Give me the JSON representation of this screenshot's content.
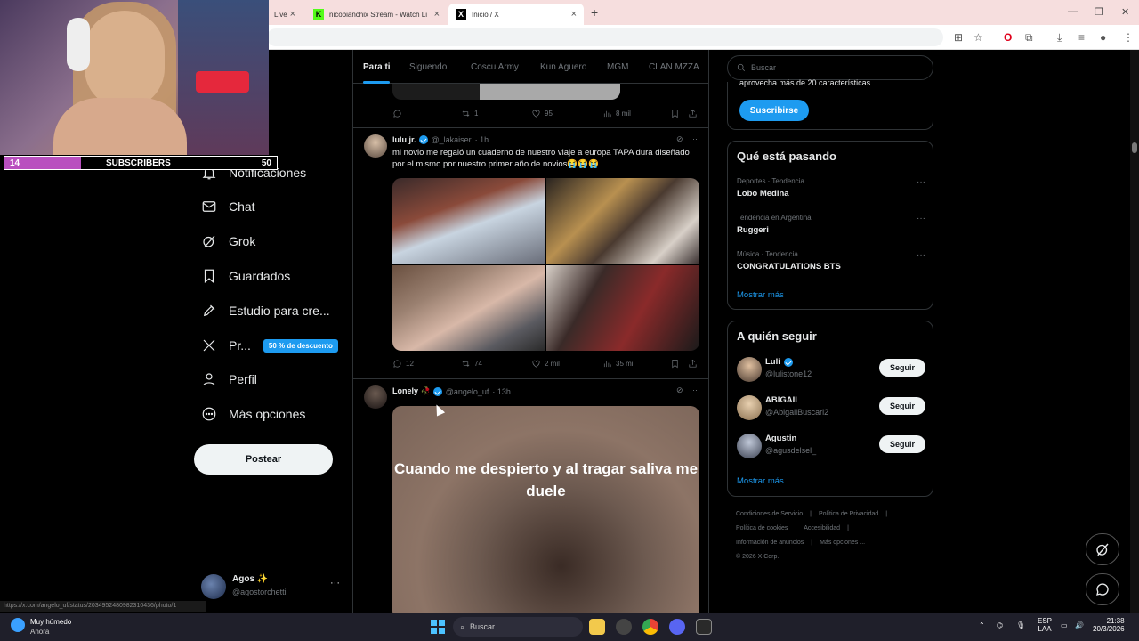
{
  "browser": {
    "tabs": [
      {
        "label": "Live"
      },
      {
        "label": "nicobianchix Stream - Watch Li"
      },
      {
        "label": "Inicio / X"
      }
    ],
    "new_tab": "+"
  },
  "stream_overlay": {
    "sub_count": "14",
    "sub_label": "SUBSCRIBERS",
    "sub_goal": "50",
    "sub_progress": 0.28
  },
  "nav": {
    "items": [
      {
        "label": "Notificaciones",
        "icon": "bell-icon"
      },
      {
        "label": "Chat",
        "icon": "mail-icon"
      },
      {
        "label": "Grok",
        "icon": "grok-icon"
      },
      {
        "label": "Guardados",
        "icon": "bookmark-icon"
      },
      {
        "label": "Estudio para cre...",
        "icon": "rocket-icon"
      },
      {
        "label": "Pr...",
        "icon": "x-logo-icon",
        "badge": "50 % de descuento"
      },
      {
        "label": "Perfil",
        "icon": "person-icon"
      },
      {
        "label": "Más opciones",
        "icon": "more-circle-icon"
      }
    ],
    "post_button": "Postear",
    "account": {
      "name": "Agos ✨",
      "handle": "@agostorchetti"
    },
    "status_url": "https://x.com/angelo_uf/status/2034952480982310436/photo/1"
  },
  "timeline": {
    "tabs": [
      "Para ti",
      "Siguendo",
      "Coscu Army",
      "Kun Aguero",
      "MGM",
      "CLAN MZZA"
    ],
    "prev_tweet_actions": {
      "replies": "",
      "reposts": "1",
      "likes": "95",
      "views": "8 mil"
    },
    "tweets": [
      {
        "name": "lulu jr.",
        "handle": "@_lakaiser",
        "time": "· 1h",
        "text": "mi novio me regaló un cuaderno de nuestro viaje a europa TAPA dura diseñado por el mismo por nuestro primer año de novios😭😭😭",
        "actions": {
          "replies": "12",
          "reposts": "74",
          "likes": "2 mil",
          "views": "35 mil"
        }
      },
      {
        "name": "Lonely 🥀",
        "handle": "@angelo_uf",
        "time": "· 13h",
        "media_caption": "Cuando me despierto y al tragar saliva me duele"
      }
    ]
  },
  "sidebar": {
    "search_placeholder": "Buscar",
    "premium_text": "aprovecha más de 20 características.",
    "subscribe_button": "Suscribirse",
    "trending_title": "Qué está pasando",
    "trends": [
      {
        "context": "Deportes · Tendencia",
        "title": "Lobo Medina"
      },
      {
        "context": "Tendencia en Argentina",
        "title": "Ruggeri"
      },
      {
        "context": "Música · Tendencia",
        "title": "CONGRATULATIONS BTS"
      }
    ],
    "show_more": "Mostrar más",
    "who_to_follow_title": "A quién seguir",
    "follow_suggestions": [
      {
        "name": "Luli",
        "handle": "@lulistone12",
        "verified": true
      },
      {
        "name": "ABIGAIL",
        "handle": "@AbigailBuscarl2",
        "verified": false
      },
      {
        "name": "Agustin",
        "handle": "@agusdelsel_",
        "verified": false
      }
    ],
    "follow_button": "Seguir",
    "footer": [
      "Condiciones de Servicio",
      "|",
      "Política de Privacidad",
      "|",
      "Política de cookies",
      "|",
      "Accesibilidad",
      "|",
      "Información de anuncios",
      "|",
      "Más opciones ...",
      "© 2026 X Corp."
    ]
  },
  "taskbar": {
    "weather_title": "Muy húmedo",
    "weather_sub": "Ahora",
    "search_placeholder": "Buscar",
    "lang": "ESP",
    "lang2": "LAA",
    "time": "21:38",
    "date": "20/3/2026"
  }
}
